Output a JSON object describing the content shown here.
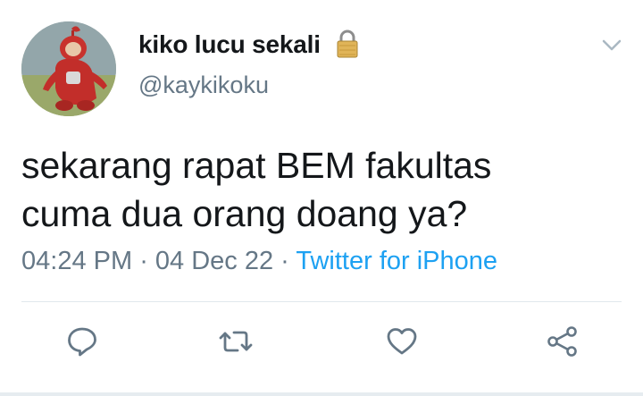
{
  "user": {
    "display_name": "kiko lucu sekali",
    "handle": "@kaykikoku",
    "protected_icon": "lock-icon",
    "avatar_icon": "teletubby-avatar"
  },
  "tweet": {
    "lines": [
      "sekarang rapat BEM fakultas",
      "cuma dua orang doang ya?"
    ],
    "time": "04:24 PM",
    "separator": " · ",
    "date": "04 Dec 22",
    "source": "Twitter for iPhone"
  },
  "actions": {
    "items": [
      "reply-icon",
      "retweet-icon",
      "like-icon",
      "share-icon"
    ]
  },
  "colors": {
    "text": "#14171a",
    "secondary": "#657786",
    "accent": "#1da1f2",
    "divider": "#e1e8ed"
  }
}
